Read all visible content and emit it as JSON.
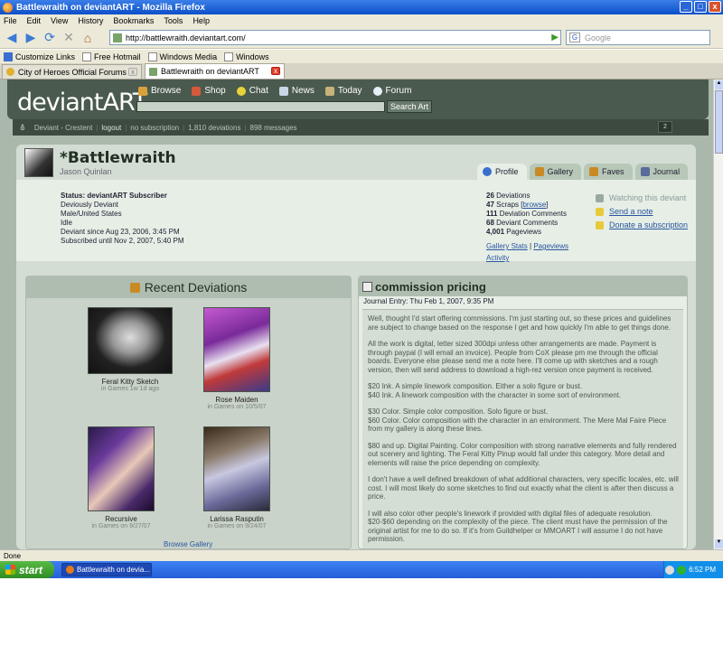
{
  "window": {
    "title": "Battlewraith on deviantART - Mozilla Firefox"
  },
  "menu": [
    "File",
    "Edit",
    "View",
    "History",
    "Bookmarks",
    "Tools",
    "Help"
  ],
  "nav": {
    "url": "http://battlewraith.deviantart.com/",
    "search_placeholder": "Google"
  },
  "bookmarks": [
    "Customize Links",
    "Free Hotmail",
    "Windows Media",
    "Windows"
  ],
  "tabs": [
    {
      "label": "City of Heroes Official Forums",
      "active": false
    },
    {
      "label": "Battlewraith on deviantART",
      "active": true
    }
  ],
  "da": {
    "logo": "deviantART",
    "nav": [
      "Browse",
      "Shop",
      "Chat",
      "News",
      "Today",
      "Forum"
    ],
    "search_button": "Search Art",
    "userbar": {
      "deviant": "Deviant - Crestent",
      "logout": "logout",
      "subscription": "no subscription",
      "deviations": "1,810 deviations",
      "messages": "898 messages",
      "msg_count": "2"
    }
  },
  "profile": {
    "username": "*Battlewraith",
    "realname": "Jason Quinlan",
    "tabs": [
      "Profile",
      "Gallery",
      "Faves",
      "Journal"
    ],
    "status": {
      "line1": "Status: deviantART Subscriber",
      "line2": "Deviously Deviant",
      "line3": "Male/United States",
      "line4": "Idle",
      "line5": "Deviant since Aug 23, 2006, 3:45 PM",
      "line6": "Subscribed until Nov 2, 2007, 5:40 PM"
    },
    "stats": {
      "deviations_n": "26",
      "deviations_l": "Deviations",
      "scraps_n": "47",
      "scraps_l": "Scraps [",
      "scraps_link": "browse",
      "scraps_end": "]",
      "devcomments_n": "111",
      "devcomments_l": "Deviation Comments",
      "deviantcomments_n": "68",
      "deviantcomments_l": "Deviant Comments",
      "pageviews_n": "4,001",
      "pageviews_l": "Pageviews",
      "gallery_stats": "Gallery Stats",
      "sep": "|",
      "pageviews_link": "Pageviews",
      "activity": "Activity"
    },
    "actions": {
      "watching": "Watching this deviant",
      "note": "Send a note",
      "subscription": "Donate a subscription"
    }
  },
  "recent": {
    "title": "Recent Deviations",
    "items": [
      {
        "title": "Feral Kitty Sketch",
        "sub": "in Games 1w 1d ago"
      },
      {
        "title": "Rose Maiden",
        "sub": "in Games on 10/5/07"
      },
      {
        "title": "Recursive",
        "sub": "in Games on 9/27/07"
      },
      {
        "title": "Larissa Rasputin",
        "sub": "in Games on 9/24/07"
      }
    ],
    "browse": "Browse Gallery"
  },
  "journal": {
    "title": "commission pricing",
    "date": "Journal Entry: Thu Feb 1, 2007, 9:35 PM",
    "paragraphs": [
      "Well, thought I'd start offering commissions. I'm just starting out, so these prices and guidelines are subject to change based on the response I get and how quickly I'm able to get things done.",
      "All the work is digital, letter sized 300dpi unless other arrangements are made. Payment is through paypal (I will email an invoice). People from CoX please pm me through the official boards. Everyone else please send me a note here. I'll come up with sketches and a rough version, then will send address to download a high-rez version once payment is received.",
      "$20 Ink. A simple linework composition. Either a solo figure or bust.\n$40 Ink. A linework composition with the character in some sort of environment.",
      "$30 Color. Simple color composition. Solo figure or bust.\n$60 Color. Color composition with the character in an environment. The Mere Mal Faire Piece from my gallery is along these lines.",
      "$80 and up. Digital Painting. Color composition with strong narrative elements and fully rendered out scenery and lighting. The Feral Kitty Pinup would fall under this category. More detail and elements will raise the price depending on complexity.",
      "I don't have a well defined breakdown of what additional characters, very specific locales, etc. will cost. I will most likely do some sketches to find out exactly what the client is after then discuss a price.",
      "I will also color other people's linework if provided with digital files of adequate resolution.\n$20-$60 depending on the complexity of the piece. The client must have the permission of the original artist for me to do so. If it's from Guildhelper or MMOART I will assume I do not have permission."
    ]
  },
  "statusbar": "Done",
  "taskbar": {
    "start": "start",
    "item": "Battlewraith on devia...",
    "time": "6:52 PM"
  }
}
